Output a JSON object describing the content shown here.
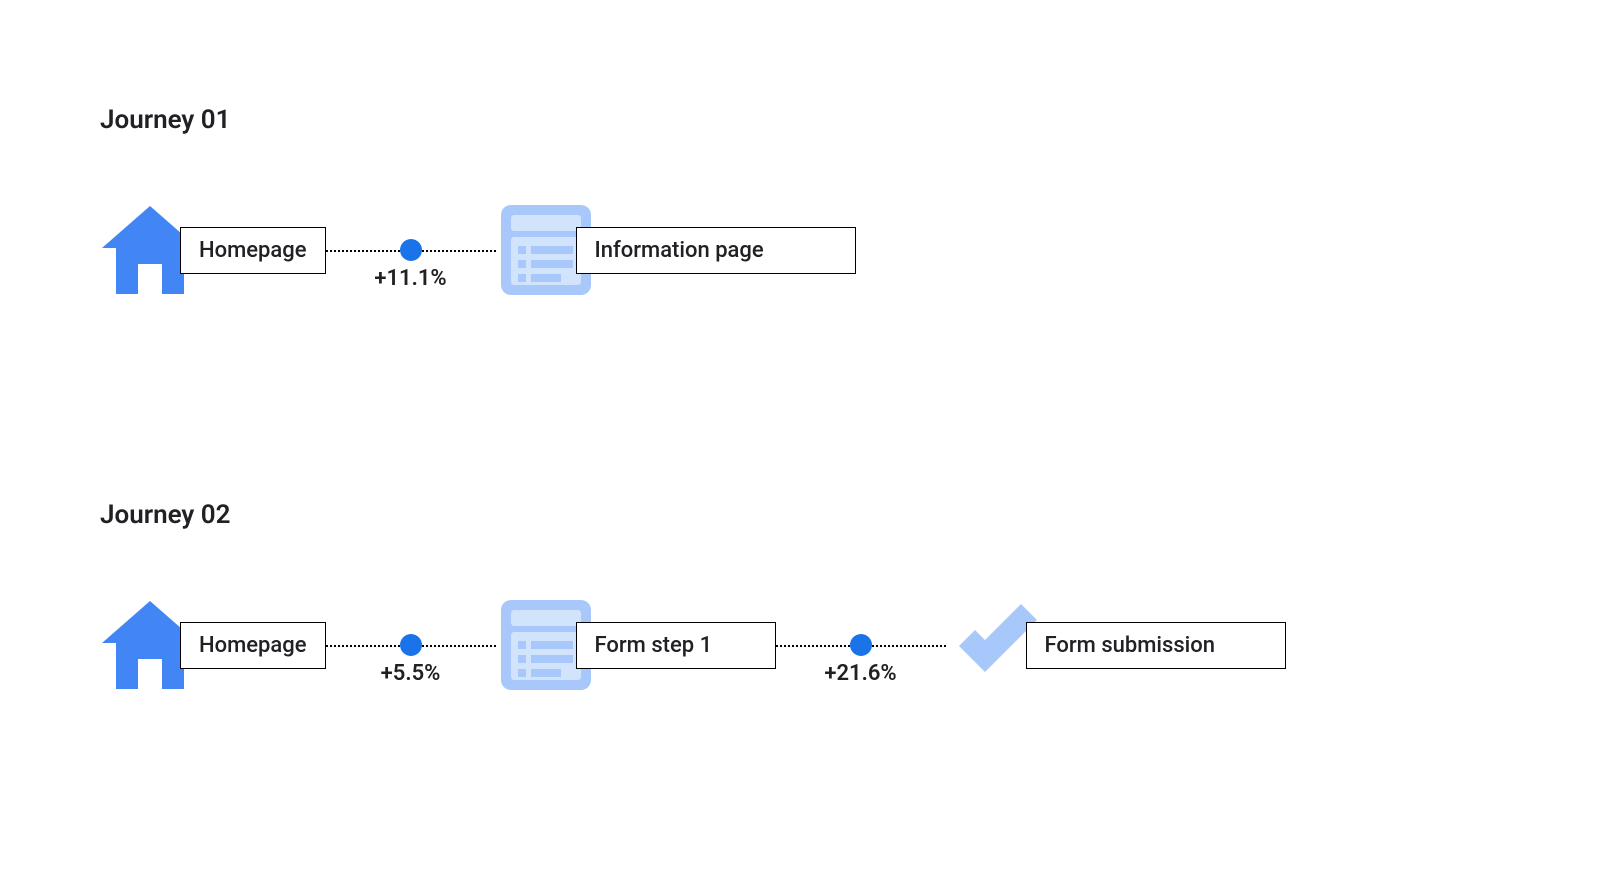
{
  "colors": {
    "blue": "#4285F4",
    "light_blue": "#A8C7FA",
    "dot_blue": "#1A73E8",
    "text": "#202124"
  },
  "journeys": [
    {
      "title": "Journey 01",
      "steps": [
        {
          "icon": "home-icon",
          "label": "Homepage"
        },
        {
          "icon": "list-icon",
          "label": "Information page"
        }
      ],
      "connectors": [
        {
          "metric": "+11.1%"
        }
      ]
    },
    {
      "title": "Journey 02",
      "steps": [
        {
          "icon": "home-icon",
          "label": "Homepage"
        },
        {
          "icon": "list-icon",
          "label": "Form step 1"
        },
        {
          "icon": "check-icon",
          "label": "Form submission"
        }
      ],
      "connectors": [
        {
          "metric": "+5.5%"
        },
        {
          "metric": "+21.6%"
        }
      ]
    }
  ]
}
